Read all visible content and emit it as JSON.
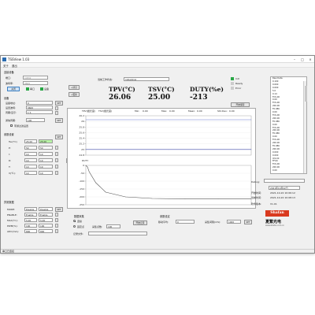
{
  "window": {
    "title": "TSSView 1.03"
  },
  "menu": [
    "关于",
    "退出"
  ],
  "connection": {
    "title": "连接设备",
    "port_label": "端口:",
    "port_value": "COM1",
    "baud_label": "波特率:",
    "baud_value": "9600",
    "connect_btn": "关闭",
    "status_port_label": "串口",
    "status_dev_label": "设备"
  },
  "device": {
    "title": "设备",
    "addr_label": "设备地址:",
    "addr_value": "0",
    "baud2_label": "设置波特:",
    "baud2_value": "9600",
    "interval_label": "周期/显示:",
    "interval_value": "1 S",
    "read_btn": "SET",
    "period_label": "通信周期:",
    "period_value": "100",
    "period_btn": "SET",
    "sync_label": "带通过滤设置"
  },
  "params": {
    "title": "参数设置",
    "rows": [
      {
        "label": "Tsv(°C)",
        "a": "25.00",
        "b": "25.00"
      },
      {
        "label": "P:",
        "a": "50",
        "b": "50"
      },
      {
        "label": "I:",
        "a": "10",
        "b": "10"
      },
      {
        "label": "D:",
        "a": "10",
        "b": "10"
      },
      {
        "label": "T:",
        "a": "10",
        "b": "10"
      },
      {
        "label": "V(℃):",
        "a": "10",
        "b": "10"
      }
    ],
    "set_btn": "SET"
  },
  "alarm": {
    "title": "异常数据",
    "rows": [
      {
        "label": "MODE:",
        "a": "Disable",
        "b": "Disable"
      },
      {
        "label": "ENABLE:",
        "a": "Enable",
        "b": "Enable"
      },
      {
        "label": "MAX(°C):",
        "a": "5.00",
        "b": "5.00"
      },
      {
        "label": "PWM(%):",
        "a": "100",
        "b": "100"
      },
      {
        "label": "ADC(mA):",
        "a": "800",
        "b": "800"
      }
    ],
    "set_btn": "SET"
  },
  "work_state": {
    "label": "当前工作状态:",
    "value": "Initializing"
  },
  "top_buttons": [
    "+清空",
    "+更新"
  ],
  "readouts": [
    {
      "name": "TPV(°C)",
      "value": "26.06"
    },
    {
      "name": "TSV(°C)",
      "value": "25.00"
    },
    {
      "name": "DUTY(%e)",
      "value": "-213"
    }
  ],
  "tabs": [
    "放大",
    "缩小",
    "回退"
  ],
  "start_btn": "开始保存",
  "chart_top": {
    "legend": [
      "TPV(摄氏度)",
      "TSV(摄氏度)"
    ],
    "min_label": "Min:",
    "min_value": "0.00",
    "max_label": "Max:",
    "max_value": "0.00",
    "mean_label": "Mean:",
    "mean_value": "0.00",
    "std_label": "Std.Dev:",
    "std_value": "0.00"
  },
  "chart_data": [
    {
      "type": "line",
      "ylabel": "",
      "y_ticks": [
        26.2,
        26,
        25.8,
        25.6,
        25.4,
        25.2,
        25,
        24.8
      ],
      "ylim": [
        24.8,
        26.2
      ],
      "series": [
        {
          "name": "TPV(摄氏度)",
          "x": [
            0,
            1,
            2
          ],
          "values": [
            26.06,
            26.06,
            26.06
          ]
        },
        {
          "name": "TSV(摄氏度)",
          "x": [
            0,
            1,
            2
          ],
          "values": [
            25.0,
            25.0,
            25.0
          ]
        }
      ],
      "colors": [
        "#6a7fd6",
        "#3d4aa8"
      ]
    },
    {
      "type": "line",
      "title": "DUTY",
      "y_ticks": [
        0,
        -50,
        -100,
        -150,
        -200,
        -250
      ],
      "ylim": [
        -250,
        0
      ],
      "series": [
        {
          "name": "DUTY",
          "x": [
            0,
            1,
            2,
            6,
            12,
            24,
            40,
            60,
            80,
            100
          ],
          "values": [
            0,
            -10,
            -40,
            -110,
            -170,
            -200,
            -210,
            -213,
            -213,
            -213
          ]
        }
      ],
      "colors": [
        "#555555"
      ]
    }
  ],
  "collect": {
    "title": "数据采集",
    "opt1": "连续",
    "opt2": "固定点",
    "count_label": "采集点数:",
    "count_value": "100",
    "save_btn": "开始记录",
    "file_label": "记录文件:",
    "file_value": ""
  },
  "paramset": {
    "title": "参数设定",
    "move_label": "移动平均:",
    "move_value": "0",
    "win_label": "采集间隔(mS):",
    "win_value": "1000",
    "btn": "SET"
  },
  "status_leds": [
    "Init",
    "Ready",
    "Error"
  ],
  "led_colors": {
    "init": "#28a745",
    "ready": "#cccccc",
    "error": "#cccccc"
  },
  "list": {
    "header": "Raw Data:",
    "items": [
      "0.100",
      "0.000",
      "0.000",
      "5.0",
      "0.14",
      "FCS.00",
      "0.00",
      "FCS.00",
      "200.00",
      "F0.086",
      "0.00",
      "FCS.00",
      "200.00",
      "F0.086",
      "0.00",
      "FCS.00",
      "200.00",
      "F0.086",
      "0.00",
      "FCS.00",
      "200.00",
      "F0.086",
      "200.00",
      "0.000",
      "0.000",
      "ICS.00",
      "FF.00",
      "FCS.00",
      "200.00",
      "0.00"
    ]
  },
  "debug": {
    "label": "Debug:",
    "value": ""
  },
  "info": {
    "date_value": "2021年10月22日",
    "start_label": "开始时间:",
    "start_value": "2021-10-22 10:06:12",
    "current_label": "当前时间:",
    "current_value": "2021-10-22 10:08:13",
    "version_label": "软件版本:",
    "version_value": "V1.01"
  },
  "brand": {
    "logo": "Shafan",
    "name": "夏繁光电",
    "url": "www.shafan.com.cn"
  },
  "statusbar": {
    "text": "串口已连接"
  }
}
